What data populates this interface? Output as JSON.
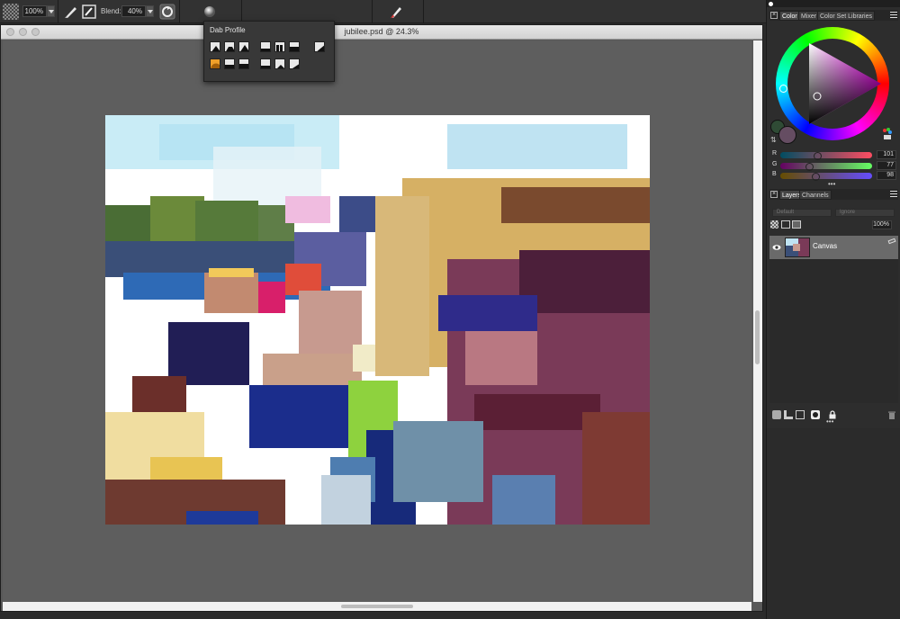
{
  "toolbar": {
    "size_value": "100%",
    "blend_label": "Blend:",
    "blend_value": "40%"
  },
  "document": {
    "title": "jubilee.psd @ 24.3%"
  },
  "dab_popup": {
    "title": "Dab Profile",
    "selected_index": 6
  },
  "color_panel": {
    "tabs": [
      "Color",
      "Mixer",
      "Color Set Libraries"
    ],
    "r_label": "R",
    "r_value": "101",
    "g_label": "G",
    "g_value": "77",
    "b_label": "B",
    "b_value": "98",
    "r_fraction": 0.4,
    "g_fraction": 0.3,
    "b_fraction": 0.38,
    "current_color": "#654d62"
  },
  "layers_panel": {
    "tabs": [
      "Layers",
      "Channels"
    ],
    "composite_method": "Default",
    "composite_option": "Ignore",
    "opacity": "100%",
    "layers": [
      {
        "name": "Canvas",
        "visible": true
      }
    ]
  },
  "icons": [
    "brush-icon",
    "eyedropper-icon",
    "reset-icon",
    "grain-icon",
    "dab-profile-icon",
    "brush-variant-icon",
    "eye-icon",
    "lock-icon",
    "trash-icon",
    "swap-colors-icon",
    "clone-color-icon"
  ]
}
